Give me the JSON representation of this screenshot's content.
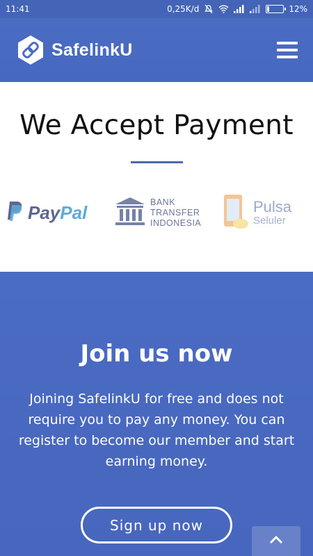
{
  "status_bar": {
    "time": "11:41",
    "network_speed": "0,25K/d",
    "battery_percent": "12%",
    "battery_level": 0.12,
    "icons": [
      "mute-icon",
      "wifi-icon",
      "signal-icon",
      "signal-icon-2",
      "battery-icon"
    ]
  },
  "navbar": {
    "brand": "SafelinkU",
    "logo_icon": "link-icon",
    "menu_icon": "hamburger-icon"
  },
  "accept": {
    "title": "We Accept Payment",
    "methods": {
      "paypal_a": "Pay",
      "paypal_b": "Pal",
      "bank_line1": "BANK",
      "bank_line2": "TRANSFER",
      "bank_line3": "INDONESIA",
      "pulsa_main": "Pulsa",
      "pulsa_sub": "Seluler"
    }
  },
  "join": {
    "title": "Join us now",
    "text": "Joining SafelinkU for free and does not require you to pay any money. You can register to become our member and start earning money.",
    "signup_label": "Sign up now",
    "scroll_top_icon": "chevron-up-icon"
  },
  "colors": {
    "primary": "#4a6cc2",
    "white": "#ffffff",
    "divider": "#4a6aa8"
  }
}
